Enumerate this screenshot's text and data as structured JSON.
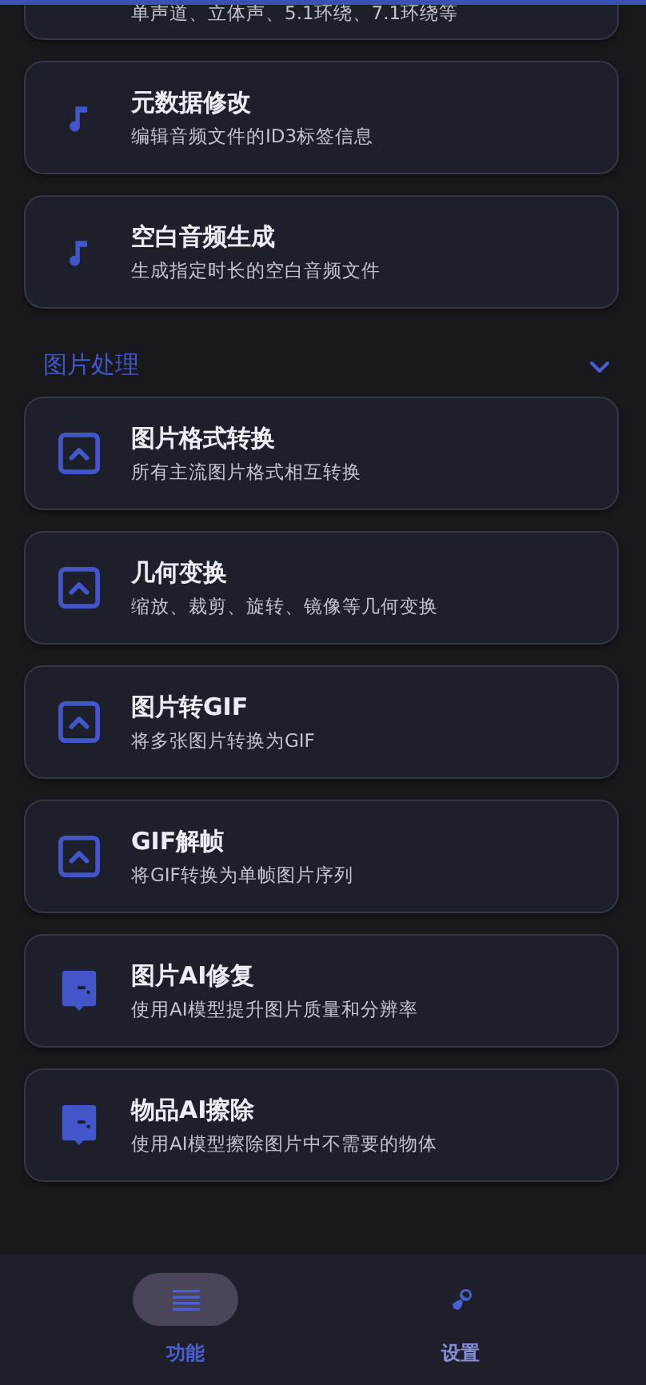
{
  "sections": [
    {
      "items": [
        {
          "kind": "none",
          "subtitle": "单声道、立体声、5.1环绕、7.1环绕等"
        },
        {
          "kind": "music",
          "title": "元数据修改",
          "subtitle": "编辑音频文件的ID3标签信息"
        },
        {
          "kind": "music",
          "title": "空白音频生成",
          "subtitle": "生成指定时长的空白音频文件"
        }
      ]
    },
    {
      "title": "图片处理",
      "expanded": true,
      "items": [
        {
          "kind": "image",
          "title": "图片格式转换",
          "subtitle": "所有主流图片格式相互转换"
        },
        {
          "kind": "image",
          "title": "几何变换",
          "subtitle": "缩放、裁剪、旋转、镜像等几何变换"
        },
        {
          "kind": "image",
          "title": "图片转GIF",
          "subtitle": "将多张图片转换为GIF"
        },
        {
          "kind": "image",
          "title": "GIF解帧",
          "subtitle": "将GIF转换为单帧图片序列"
        },
        {
          "kind": "ai",
          "title": "图片AI修复",
          "subtitle": "使用AI模型提升图片质量和分辨率"
        },
        {
          "kind": "ai",
          "title": "物品AI擦除",
          "subtitle": "使用AI模型擦除图片中不需要的物体"
        }
      ]
    }
  ],
  "nav": [
    {
      "kind": "menu",
      "label": "功能",
      "selected": true
    },
    {
      "kind": "settings",
      "label": "设置",
      "selected": false
    }
  ]
}
